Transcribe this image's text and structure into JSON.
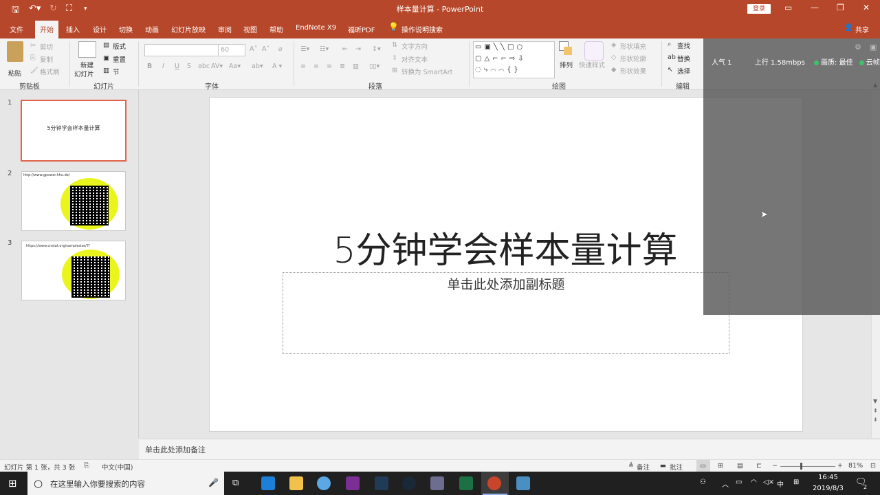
{
  "window": {
    "title": "样本量计算 - PowerPoint",
    "login_label": "登录",
    "share_label": "共享",
    "minimize_icon": "minimize-icon",
    "restore_icon": "restore-icon",
    "close_icon": "close-icon"
  },
  "tabs": [
    "文件",
    "开始",
    "插入",
    "设计",
    "切换",
    "动画",
    "幻灯片放映",
    "审阅",
    "视图",
    "帮助",
    "EndNote X9",
    "福昕PDF"
  ],
  "tell_me": "操作说明搜索",
  "ribbon": {
    "clipboard": {
      "label": "剪贴板",
      "paste": "粘贴",
      "cut": "剪切",
      "copy": "复制",
      "format_painter": "格式刷"
    },
    "slides": {
      "label": "幻灯片",
      "new_slide_1": "新建",
      "new_slide_2": "幻灯片",
      "layout": "版式",
      "reset": "重置",
      "section": "节"
    },
    "font": {
      "label": "字体",
      "size": "60",
      "bold": "B",
      "italic": "I",
      "underline": "U",
      "strike": "S"
    },
    "paragraph": {
      "label": "段落",
      "text_direction": "文字方向",
      "align_text": "对齐文本",
      "smartart": "转换为 SmartArt"
    },
    "drawing": {
      "label": "绘图",
      "arrange": "排列",
      "quick_styles": "快速样式",
      "shape_fill": "形状填充",
      "shape_outline": "形状轮廓",
      "shape_effects": "形状效果"
    },
    "editing": {
      "label": "编辑",
      "find": "查找",
      "replace": "替换",
      "select": "选择"
    }
  },
  "overlay": {
    "popularity": "人气 1",
    "upload": "上行 1.58mbps",
    "quality": "画质: 最佳",
    "cloud": "云帧"
  },
  "thumbnails": [
    {
      "num": "1",
      "text": "5分钟学会样本量计算"
    },
    {
      "num": "2",
      "text": "http://www.gpower.hhu.de/"
    },
    {
      "num": "3",
      "text": "https://www.cnstat.org/samplesize/7/"
    }
  ],
  "slide": {
    "title": "5分钟学会样本量计算",
    "subtitle_placeholder": "单击此处添加副标题"
  },
  "notes_placeholder": "单击此处添加备注",
  "status": {
    "slide_info": "幻灯片 第 1 张，共 3 张",
    "language": "中文(中国)",
    "notes": "备注",
    "comments": "批注",
    "zoom": "81%"
  },
  "taskbar": {
    "search_placeholder": "在这里输入你要搜索的内容",
    "time": "16:45",
    "date": "2019/8/3",
    "ime": "中",
    "notification_count": "2"
  },
  "colors": {
    "accent": "#b7472a",
    "selected_thumb_border": "#e2624a",
    "qr_background": "#e9f51d",
    "status_dot": "#3cc36c"
  }
}
